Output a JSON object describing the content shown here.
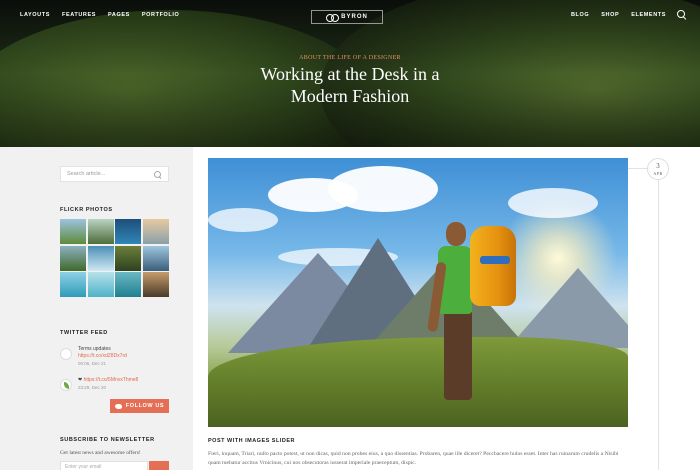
{
  "nav": {
    "left": [
      "LAYOUTS",
      "FEATURES",
      "PAGES",
      "PORTFOLIO"
    ],
    "right": [
      "BLOG",
      "SHOP",
      "ELEMENTS"
    ],
    "logo": "BYRON"
  },
  "hero": {
    "subtitle": "ABOUT THE LIFE OF A DESIGNER",
    "title_line1": "Working at the Desk in a",
    "title_line2": "Modern Fashion"
  },
  "sidebar": {
    "search_placeholder": "Search article...",
    "flickr_title": "FLICKR PHOTOS",
    "twitter_title": "TWITTER FEED",
    "tweets": [
      {
        "line1": "Terms updates",
        "link": "https://t.co/xdZ8Dx7rd",
        "time": "00:06, Dec 21"
      },
      {
        "line1": "❤",
        "link": "https://t.co/5MnvxThme8",
        "time": "23:29, Dec 20"
      }
    ],
    "follow_label": "FOLLOW US",
    "newsletter_title": "SUBSCRIBE TO NEWSLETTER",
    "newsletter_desc": "Get latest news and awesome offers!",
    "email_placeholder": "Enter your email"
  },
  "post": {
    "label": "POST WITH IMAGES SLIDER",
    "excerpt": "Fieri, inquam, Triari, nullo pacto potest, ut non dicas, quid non probes eius, a quo dissentias. Probaren, quae ille diceret? Peccbacere hulus esset. Inter has ruinarum crudelis a Nisibi quam tuebatur accitus Vrnicinus, cui nos obsecutoras iusserat imperiale praeceptum, dispic."
  },
  "date": {
    "day": "3",
    "month": "APR"
  },
  "colors": {
    "accent": "#e56f55",
    "sidebar_bg": "#f1f1f1"
  }
}
